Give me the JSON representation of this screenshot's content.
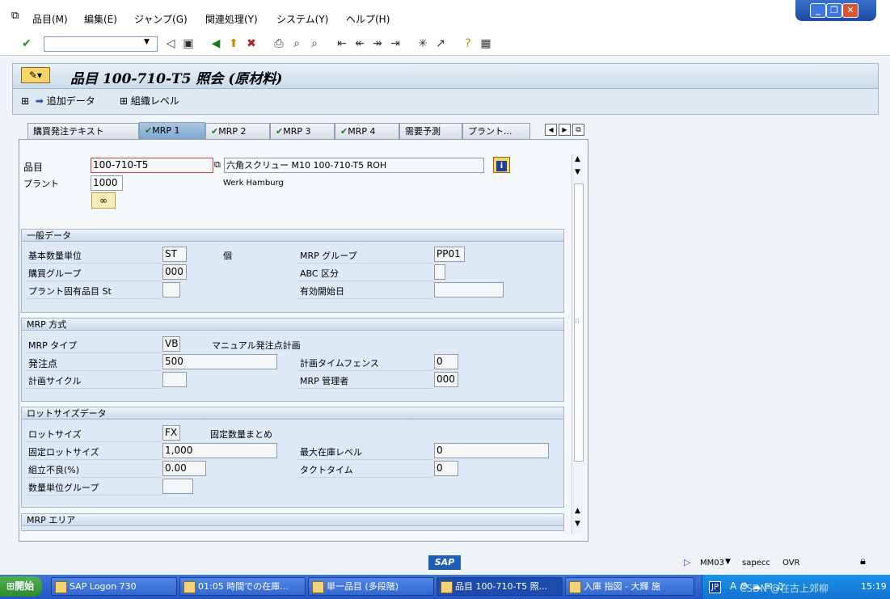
{
  "menu": [
    "品目(M)",
    "編集(E)",
    "ジャンプ(G)",
    "関連処理(Y)",
    "システム(Y)",
    "ヘルプ(H)"
  ],
  "window_controls": {
    "minimize": "_",
    "restore": "❐",
    "close": "✕"
  },
  "title": "品目 100-710-T5 照会 (原材料)",
  "app_toolbar": {
    "additional_data": "追加データ",
    "org_levels": "組織レベル"
  },
  "tabs": [
    "購買発注テキスト",
    "MRP 1",
    "MRP 2",
    "MRP 3",
    "MRP 4",
    "需要予測",
    "プラント..."
  ],
  "active_tab_index": 1,
  "header": {
    "material_label": "品目",
    "material_value": "100-710-T5",
    "material_desc": "六角スクリュー M10 100-710-T5 ROH",
    "plant_label": "プラント",
    "plant_value": "1000",
    "plant_desc": "Werk Hamburg"
  },
  "general": {
    "title": "一般データ",
    "base_uom_label": "基本数量単位",
    "base_uom_value": "ST",
    "base_uom_text": "個",
    "mrp_group_label": "MRP グループ",
    "mrp_group_value": "PP01",
    "purch_group_label": "購買グループ",
    "purch_group_value": "000",
    "abc_label": "ABC 区分",
    "abc_value": "",
    "plant_status_label": "プラント固有品目 St",
    "plant_status_value": "",
    "valid_from_label": "有効開始日",
    "valid_from_value": ""
  },
  "mrp_procedure": {
    "title": "MRP 方式",
    "type_label": "MRP タイプ",
    "type_value": "VB",
    "type_text": "マニュアル発注点計画",
    "reorder_label": "発注点",
    "reorder_value": "500",
    "fence_label": "計画タイムフェンス",
    "fence_value": "0",
    "cycle_label": "計画サイクル",
    "cycle_value": "",
    "controller_label": "MRP 管理者",
    "controller_value": "000"
  },
  "lot_size": {
    "title": "ロットサイズデータ",
    "lot_label": "ロットサイズ",
    "lot_value": "FX",
    "lot_text": "固定数量まとめ",
    "fixed_label": "固定ロットサイズ",
    "fixed_value": "1,000",
    "max_stock_label": "最大在庫レベル",
    "max_stock_value": "0",
    "scrap_label": "組立不良(%)",
    "scrap_value": "0.00",
    "takt_label": "タクトタイム",
    "takt_value": "0",
    "rounding_label": "数量単位グループ",
    "rounding_value": ""
  },
  "mrp_area": {
    "title": "MRP エリア"
  },
  "status": {
    "sap_logo": "SAP",
    "transaction": "MM03",
    "server": "sapecc",
    "mode": "OVR"
  },
  "taskbar": {
    "start": "開始",
    "tasks": [
      "SAP Logon 730",
      "01:05 時間での在庫...",
      "単一品目 (多段階)",
      "品目 100-710-T5 照...",
      "入庫 指図 - 大輝 施"
    ],
    "lang": "JP",
    "clock": "15:19",
    "watermark": "CSDN @在古上郊柳"
  }
}
